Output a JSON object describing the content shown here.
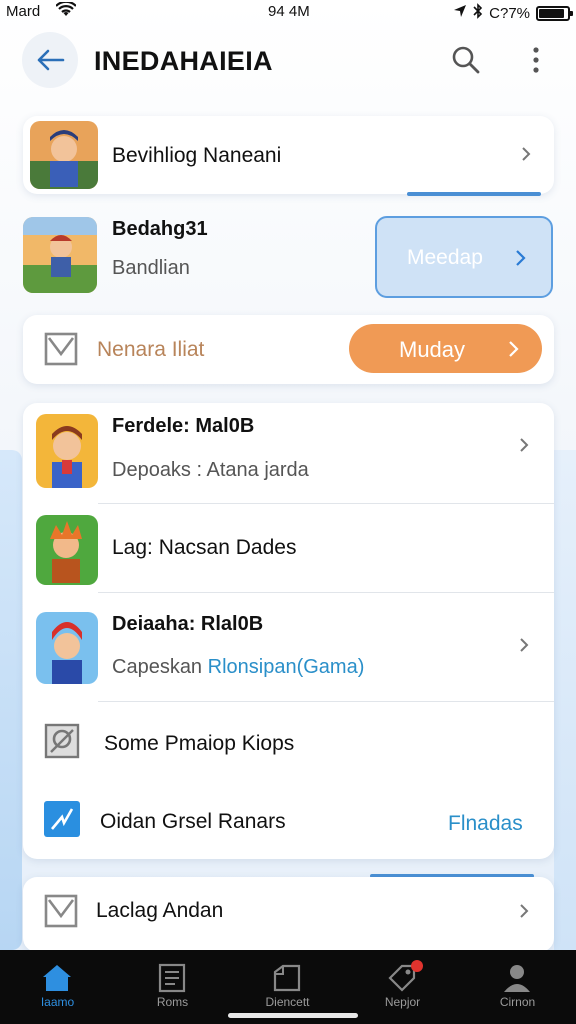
{
  "status_bar": {
    "carrier": "Mard",
    "time": "94 4M",
    "battery": "C?7%",
    "battery_level": 0.9
  },
  "header": {
    "title": "INEDAHAIEIA",
    "icons": [
      "back-arrow-icon",
      "search-icon",
      "more-vert-icon"
    ]
  },
  "colors": {
    "accent_blue": "#4a8fd4",
    "orange": "#f09a55",
    "link_blue": "#2a8fc9",
    "nav_active": "#2e8fe0"
  },
  "card1": {
    "title": "Bevihliog Naneani"
  },
  "promo": {
    "title": "Bedahg31",
    "subtitle": "Bandlian",
    "button_label": "Meedap"
  },
  "notice": {
    "title": "Nenara Iliat",
    "button_label": "Muday"
  },
  "list": [
    {
      "title": "Ferdele: Mal0B",
      "subtitle": "Depoaks : Atana jarda",
      "chevron": true
    },
    {
      "title": "Lag: Nacsan Dades"
    },
    {
      "title": "Deiaaha: Rlal0B",
      "subtitle_plain": "Capeskan ",
      "subtitle_link": "Rlonsipan(Gama)",
      "chevron": true
    },
    {
      "title": "Some Pmaiop Kiops"
    },
    {
      "title": "Oidan Grsel Ranars",
      "action": "Flnadas"
    }
  ],
  "last_card": {
    "title": "Laclag Andan"
  },
  "bottom_nav": [
    {
      "label": "Iaamo",
      "icon": "home-icon",
      "active": true
    },
    {
      "label": "Roms",
      "icon": "list-icon",
      "active": false
    },
    {
      "label": "Diencett",
      "icon": "folder-icon",
      "active": false
    },
    {
      "label": "Nepjor",
      "icon": "tag-icon",
      "active": false,
      "badge": true
    },
    {
      "label": "Cirnon",
      "icon": "profile-icon",
      "active": false
    }
  ]
}
